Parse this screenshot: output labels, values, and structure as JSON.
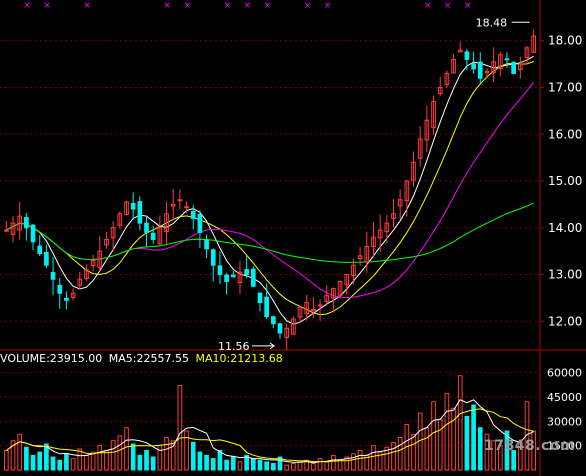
{
  "colors": {
    "background": "#000000",
    "grid": "#7a0000",
    "axis": "#b00000",
    "axis_text": "#ffffff",
    "up_candle": "#ff3c3c",
    "down_candle": "#00f0f0",
    "ma5": "#ffffff",
    "ma10": "#ffff00",
    "ma20": "#ff00ff",
    "ma60": "#00ff00",
    "marker": "#ff00ff"
  },
  "legend": {
    "volume": "VOLUME:23915.00",
    "ma5": "MA5:22557.55",
    "ma10": "MA10:21213.68"
  },
  "watermark": "17848.com",
  "chart_data": [
    {
      "type": "candlestick",
      "ylim": [
        11.6,
        18.7
      ],
      "yticks": [
        "18.00",
        "17.00",
        "16.00",
        "15.00",
        "14.00",
        "13.00",
        "12.00"
      ],
      "annotations": [
        {
          "text": "18.48",
          "value": 18.48,
          "kind": "high"
        },
        {
          "text": "11.56",
          "value": 11.56,
          "kind": "low"
        }
      ],
      "series": [
        {
          "name": "MA5",
          "color": "#ffffff"
        },
        {
          "name": "MA10",
          "color": "#ffff00"
        },
        {
          "name": "MA20",
          "color": "#ff00ff"
        },
        {
          "name": "MA60",
          "color": "#00ff00"
        }
      ],
      "closes": [
        13.95,
        14.1,
        14.25,
        14.0,
        13.7,
        13.45,
        13.2,
        12.9,
        12.6,
        12.45,
        12.6,
        12.9,
        13.1,
        13.3,
        13.5,
        13.75,
        14.0,
        14.3,
        14.55,
        14.4,
        14.1,
        13.9,
        13.75,
        14.0,
        14.3,
        14.5,
        14.6,
        14.45,
        14.2,
        13.9,
        13.55,
        13.2,
        13.0,
        12.85,
        12.95,
        13.05,
        13.0,
        12.75,
        12.4,
        12.1,
        11.95,
        11.75,
        11.85,
        12.05,
        12.3,
        12.4,
        12.25,
        12.35,
        12.55,
        12.7,
        12.85,
        13.0,
        13.2,
        13.4,
        13.6,
        13.8,
        13.95,
        14.1,
        14.3,
        14.6,
        15.0,
        15.4,
        15.9,
        16.3,
        16.7,
        17.0,
        17.3,
        17.6,
        17.8,
        17.6,
        17.4,
        17.2,
        17.35,
        17.55,
        17.7,
        17.6,
        17.3,
        17.5,
        17.85,
        18.1
      ]
    },
    {
      "type": "bar",
      "ylim": [
        0,
        64000
      ],
      "yticks": [
        "60000",
        "45000",
        "30000",
        "15000"
      ],
      "series": [
        {
          "name": "VOLUME",
          "value": 23915.0
        },
        {
          "name": "MA5",
          "value": 22557.55
        },
        {
          "name": "MA10",
          "value": 21213.68
        }
      ],
      "values": [
        12000,
        18000,
        22000,
        14000,
        9000,
        11000,
        16000,
        8000,
        6000,
        10000,
        7000,
        13000,
        9000,
        11000,
        15000,
        12000,
        18000,
        21000,
        26000,
        16000,
        9000,
        12000,
        8000,
        15000,
        20000,
        18000,
        52000,
        24000,
        17000,
        11000,
        9000,
        7000,
        12000,
        6000,
        8000,
        5000,
        9000,
        7000,
        6000,
        5000,
        4000,
        8000,
        3000,
        4000,
        5000,
        6000,
        4000,
        7000,
        5000,
        9000,
        6000,
        8000,
        10000,
        12000,
        9000,
        15000,
        11000,
        14000,
        17000,
        20000,
        28000,
        22000,
        35000,
        26000,
        42000,
        31000,
        47000,
        38000,
        58000,
        33000,
        40000,
        26000,
        22000,
        18000,
        15000,
        24000,
        12000,
        16000,
        42000,
        23915
      ]
    }
  ]
}
